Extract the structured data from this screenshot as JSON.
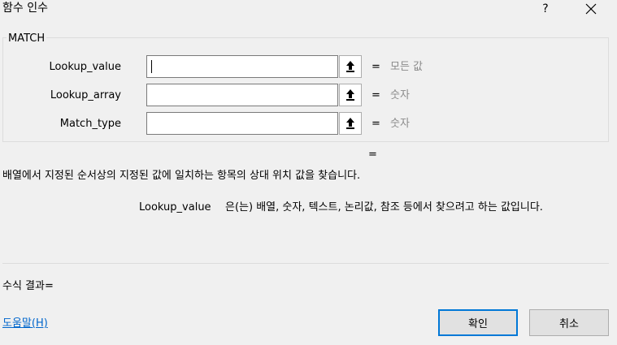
{
  "window": {
    "title": "함수 인수",
    "help_glyph": "?",
    "close_glyph": "close-icon"
  },
  "function": {
    "name": "MATCH",
    "description": "배열에서 지정된 순서상의 지정된 값에 일치하는 항목의 상대 위치 값을 찾습니다.",
    "result_equals": "="
  },
  "arguments": [
    {
      "label": "Lookup_value",
      "value": "",
      "equals": "=",
      "hint": "모든 값",
      "focused": true
    },
    {
      "label": "Lookup_array",
      "value": "",
      "equals": "=",
      "hint": "숫자",
      "focused": false
    },
    {
      "label": "Match_type",
      "value": "",
      "equals": "=",
      "hint": "숫자",
      "focused": false
    }
  ],
  "argument_help": {
    "name": "Lookup_value",
    "text": "은(는) 배열, 숫자, 텍스트, 논리값, 참조 등에서 찾으려고 하는 값입니다."
  },
  "formula_result": "수식 결과=",
  "help_link": "도움말(H)",
  "buttons": {
    "ok": "확인",
    "cancel": "취소"
  },
  "icons": {
    "ref_button": "collapse-dialog-arrow-icon"
  },
  "colors": {
    "background": "#f0f0f0",
    "link": "#0066cc",
    "hint": "#8a8a8a",
    "ok_border": "#0078d7"
  }
}
